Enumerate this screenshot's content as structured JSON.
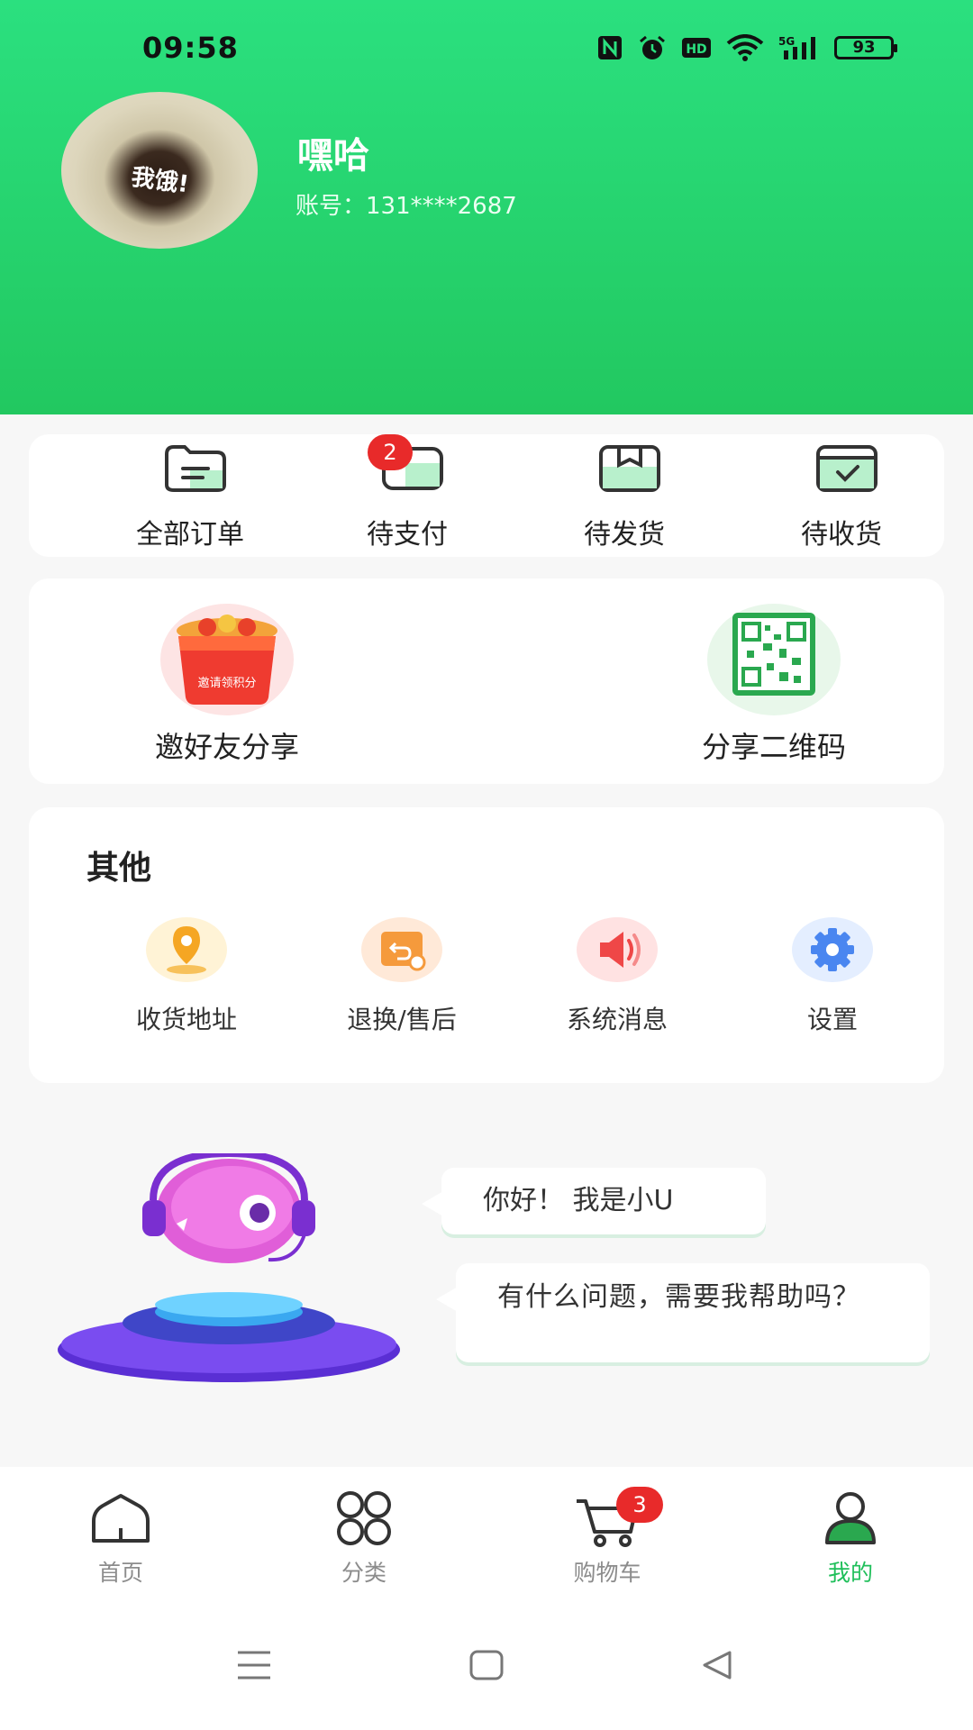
{
  "status_bar": {
    "time": "09:58",
    "battery": "93",
    "icons": [
      "nfc-icon",
      "alarm-icon",
      "hd-icon",
      "wifi-icon",
      "5g-signal-icon",
      "battery-icon"
    ]
  },
  "profile": {
    "avatar_text": "我饿!",
    "name": "嘿哈",
    "account": "账号：131****2687"
  },
  "orders": [
    {
      "label": "全部订单",
      "icon": "all-orders-icon"
    },
    {
      "label": "待支付",
      "icon": "pending-payment-icon",
      "badge": "2"
    },
    {
      "label": "待发货",
      "icon": "pending-shipment-icon"
    },
    {
      "label": "待收货",
      "icon": "pending-receipt-icon"
    }
  ],
  "share": [
    {
      "label": "邀好友分享",
      "icon": "invite-gift-icon",
      "image_text": "邀请领积分"
    },
    {
      "label": "分享二维码",
      "icon": "qr-code-icon"
    }
  ],
  "other": {
    "title": "其他",
    "items": [
      {
        "label": "收货地址",
        "icon": "location-icon"
      },
      {
        "label": "退换/售后",
        "icon": "return-icon"
      },
      {
        "label": "系统消息",
        "icon": "speaker-icon"
      },
      {
        "label": "设置",
        "icon": "gear-icon"
      }
    ]
  },
  "assistant": {
    "greeting": "你好！ 我是小U",
    "question": "有什么问题，需要我帮助吗？"
  },
  "bottom_nav": [
    {
      "label": "首页",
      "icon": "home-icon"
    },
    {
      "label": "分类",
      "icon": "category-icon"
    },
    {
      "label": "购物车",
      "icon": "cart-icon",
      "badge": "3"
    },
    {
      "label": "我的",
      "icon": "profile-icon",
      "active": true
    }
  ],
  "colors": {
    "brand_green": "#22c860",
    "badge_red": "#e82a2a",
    "active_tab": "#1fbf5a"
  }
}
